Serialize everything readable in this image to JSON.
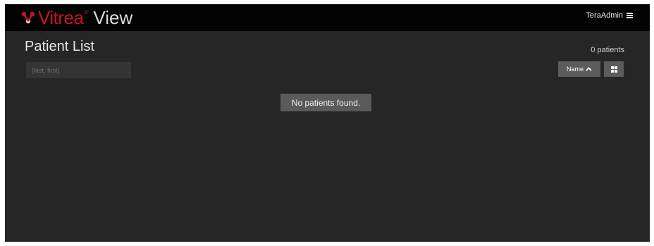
{
  "header": {
    "brand": "Vitrea",
    "brand_mark": "®",
    "product": "View",
    "user_name": "TeraAdmin",
    "menu_icon": "hamburger-icon",
    "brand_color": "#c8102e"
  },
  "page": {
    "title": "Patient List",
    "patient_count": "0 patients"
  },
  "search": {
    "placeholder": "(last, first)",
    "value": ""
  },
  "toolbar": {
    "sort_label": "Name",
    "sort_icon": "chevron-up-icon",
    "view_toggle_icon": "grid-icon"
  },
  "empty_state": {
    "message": "No patients found."
  }
}
